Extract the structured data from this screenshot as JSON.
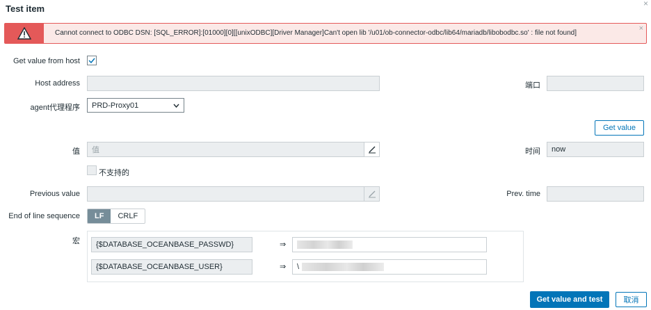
{
  "dialog": {
    "title": "Test item",
    "close_glyph": "×"
  },
  "error": {
    "message": "Cannot connect to ODBC DSN: [SQL_ERROR]:[01000][0][[unixODBC][Driver Manager]Can't open lib '/u01/ob-connector-odbc/lib64/mariadb/libobodbc.so' : file not found]",
    "close_glyph": "×",
    "color": "#e45959"
  },
  "form": {
    "get_value_from_host_label": "Get value from host",
    "get_value_from_host_checked": true,
    "host_address_label": "Host address",
    "host_address_value": "",
    "port_label": "端口",
    "port_value": "",
    "proxy_label": "agent代理程序",
    "proxy_selected": "PRD-Proxy01",
    "get_value_button": "Get value",
    "value_label": "值",
    "value_placeholder": "值",
    "time_label": "时间",
    "time_value": "now",
    "not_supported_label": "不支持的",
    "previous_value_label": "Previous value",
    "prev_time_label": "Prev. time",
    "eol_label": "End of line sequence",
    "eol_options": [
      "LF",
      "CRLF"
    ],
    "eol_selected": "LF",
    "macros_label": "宏",
    "macros": [
      {
        "name": "{$DATABASE_OCEANBASE_PASSWD}",
        "arrow": "⇒",
        "value": ""
      },
      {
        "name": "{$DATABASE_OCEANBASE_USER}",
        "arrow": "⇒",
        "value": "\\"
      }
    ]
  },
  "footer": {
    "submit_button": "Get value and test",
    "cancel_button": "取消"
  },
  "colors": {
    "primary": "#0275b8",
    "segment_active": "#768d99"
  }
}
